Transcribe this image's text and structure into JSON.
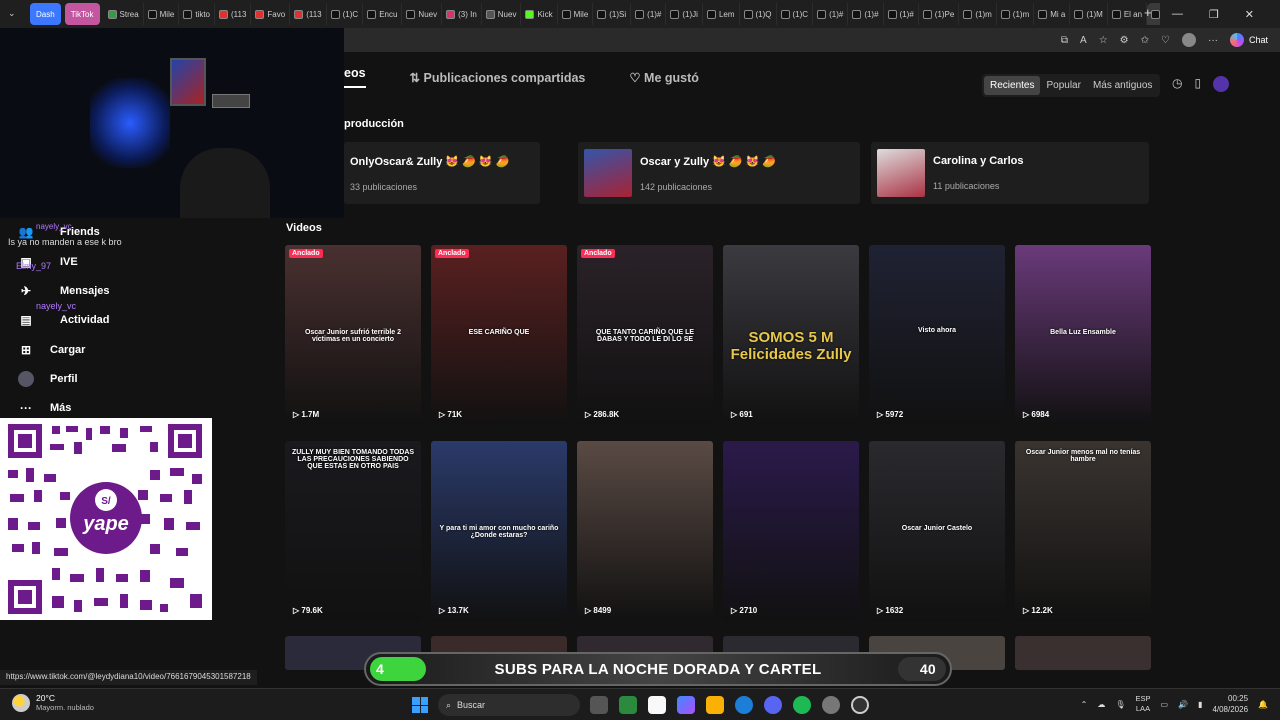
{
  "browser": {
    "tabs": [
      {
        "label": "Dash",
        "color": "#3c78ff",
        "pill": true
      },
      {
        "label": "TikTok",
        "color": "#c4569f",
        "pill": true
      },
      {
        "label": "Strea",
        "color": "#2f9e44"
      },
      {
        "label": "Mile",
        "color": "#111111"
      },
      {
        "label": "tikto",
        "color": "#111111"
      },
      {
        "label": "(113",
        "color": "#e03131"
      },
      {
        "label": "Favo",
        "color": "#e03131"
      },
      {
        "label": "(113",
        "color": "#e03131"
      },
      {
        "label": "(1)C",
        "color": "#111111"
      },
      {
        "label": "Encu",
        "color": "#111111"
      },
      {
        "label": "Nuev",
        "color": "#111111"
      },
      {
        "label": "(3) In",
        "color": "#d6336c"
      },
      {
        "label": "Nuev",
        "color": "#555555"
      },
      {
        "label": "Kick",
        "color": "#53fc18"
      },
      {
        "label": "Mile",
        "color": "#111111"
      },
      {
        "label": "(1)Si",
        "color": "#111111"
      },
      {
        "label": "(1)#",
        "color": "#111111"
      },
      {
        "label": "(1)Ji",
        "color": "#111111"
      },
      {
        "label": "Lem",
        "color": "#111111"
      },
      {
        "label": "(1)Q",
        "color": "#111111"
      },
      {
        "label": "(1)C",
        "color": "#111111"
      },
      {
        "label": "(1)#",
        "color": "#111111"
      },
      {
        "label": "(1)#",
        "color": "#111111"
      },
      {
        "label": "(1)#",
        "color": "#111111"
      },
      {
        "label": "(1)Pe",
        "color": "#111111"
      },
      {
        "label": "(1)m",
        "color": "#111111"
      },
      {
        "label": "(1)m",
        "color": "#111111"
      },
      {
        "label": "Mi a",
        "color": "#111111"
      },
      {
        "label": "(1)M",
        "color": "#111111"
      },
      {
        "label": "El an",
        "color": "#111111"
      },
      {
        "label": "L",
        "color": "#111111",
        "active": true
      }
    ],
    "new_tab": "+",
    "chat_label": "Chat"
  },
  "profile_tabs": {
    "videos": "eos",
    "shared": "Publicaciones compartidas",
    "liked": "Me gustó"
  },
  "sort": {
    "recent": "Recientes",
    "popular": "Popular",
    "oldest": "Más antiguos"
  },
  "playlists_title": "producción",
  "playlists": [
    {
      "title": "OnlyOscar& Zully 😻 🥭 😻 🥭",
      "count": "33 publicaciones",
      "color": "#1e1e1e"
    },
    {
      "title": "Oscar y Zully 😻 🥭 😻 🥭",
      "count": "142 publicaciones",
      "color": "#3355aa"
    },
    {
      "title": "Carolina y Carlos",
      "count": "11 publicaciones",
      "color": "#aa3344"
    }
  ],
  "videos_label": "Videos",
  "sidebar": {
    "friends": "Friends",
    "live": "IVE",
    "messages": "Mensajes",
    "activity": "Actividad",
    "upload": "Cargar",
    "profile": "Perfil",
    "more": "Más"
  },
  "chat_overlay": [
    {
      "user": "nayely_vc",
      "text": "Is ya no manden a ese k bro"
    },
    {
      "user": "Elmy_97",
      "text": ""
    },
    {
      "user": "nayely_vc",
      "text": ""
    }
  ],
  "videos": [
    {
      "views": "1.7M",
      "pinned": true,
      "caption": "Oscar Junior sufrió terrible 2 víctimas en un concierto",
      "bg": "#4a3030"
    },
    {
      "views": "71K",
      "pinned": true,
      "caption": "ESE CARIÑO QUE",
      "bg": "#5a2020"
    },
    {
      "views": "286.8K",
      "pinned": true,
      "caption": "QUE TANTO CARIÑO QUE LE DABAS Y TODO LE DI LO SE",
      "bg": "#2a2228"
    },
    {
      "views": "691",
      "pinned": false,
      "caption": "SOMOS 5 M Felicidades Zully",
      "bg": "#3a3a40"
    },
    {
      "views": "5972",
      "pinned": false,
      "caption": "Visto ahora",
      "bg": "#1f2233"
    },
    {
      "views": "6984",
      "pinned": false,
      "caption": "Bella Luz Ensamble",
      "bg": "#6a3a7a"
    },
    {
      "views": "79.6K",
      "pinned": false,
      "caption": "ZULLY MUY BIEN TOMANDO TODAS LAS PRECAUCIONES SABIENDO QUE ESTAS EN OTRO PAIS",
      "bg": "#1a1a1e"
    },
    {
      "views": "13.7K",
      "pinned": false,
      "caption": "Y para ti mi amor con mucho cariño ¿Donde estaras?",
      "bg": "#2a3a6a"
    },
    {
      "views": "8499",
      "pinned": false,
      "caption": "",
      "bg": "#5a4a44"
    },
    {
      "views": "2710",
      "pinned": false,
      "caption": "",
      "bg": "#2a1a4a"
    },
    {
      "views": "1632",
      "pinned": false,
      "caption": "Oscar Junior Castelo",
      "bg": "#2a2a2e"
    },
    {
      "views": "12.2K",
      "pinned": false,
      "caption": "Oscar Junior menos mal no tenías hambre",
      "bg": "#3a3430"
    }
  ],
  "pinned_label": "Anclado",
  "status_url": "https://www.tiktok.com/@leydydiana10/video/7661679045301587218",
  "subs_banner": {
    "left": "4",
    "text": "SUBS PARA LA NOCHE DORADA Y CARTEL",
    "right": "40"
  },
  "taskbar": {
    "temp": "20°C",
    "weather": "Mayorm. nublado",
    "search": "Buscar",
    "lang1": "ESP",
    "lang2": "LAA",
    "time": "00:25",
    "date": "4/08/2026"
  }
}
